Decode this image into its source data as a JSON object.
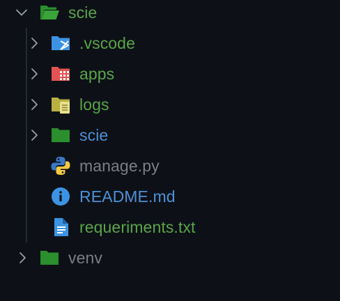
{
  "explorer": {
    "root": {
      "label": "scie",
      "expanded": true,
      "label_color": "#5aa44a",
      "icon": "folder-open-icon",
      "icon_color": "#2a8f2c"
    },
    "children": [
      {
        "label": ".vscode",
        "type": "folder",
        "icon": "vscode-folder-icon",
        "label_color": "#5aa44a",
        "icon_color": "#3d93e3"
      },
      {
        "label": "apps",
        "type": "folder",
        "icon": "apps-folder-icon",
        "label_color": "#5aa44a",
        "icon_color": "#e35252"
      },
      {
        "label": "logs",
        "type": "folder",
        "icon": "logs-folder-icon",
        "label_color": "#5aa44a",
        "icon_color": "#b9b043"
      },
      {
        "label": "scie",
        "type": "folder",
        "icon": "folder-icon",
        "label_color": "#4e8fd6",
        "icon_color": "#2a8f2c"
      },
      {
        "label": "manage.py",
        "type": "file",
        "icon": "python-icon",
        "label_color": "#7b7d82"
      },
      {
        "label": "README.md",
        "type": "file",
        "icon": "info-icon",
        "label_color": "#4e8fd6",
        "icon_color": "#3d93e3"
      },
      {
        "label": "requeriments.txt",
        "type": "file",
        "icon": "text-file-icon",
        "label_color": "#5aa44a",
        "icon_color": "#3d93e3"
      }
    ],
    "sibling": {
      "label": "venv",
      "expanded": false,
      "label_color": "#7b7d82",
      "icon": "folder-icon",
      "icon_color": "#2a8f2c"
    }
  }
}
